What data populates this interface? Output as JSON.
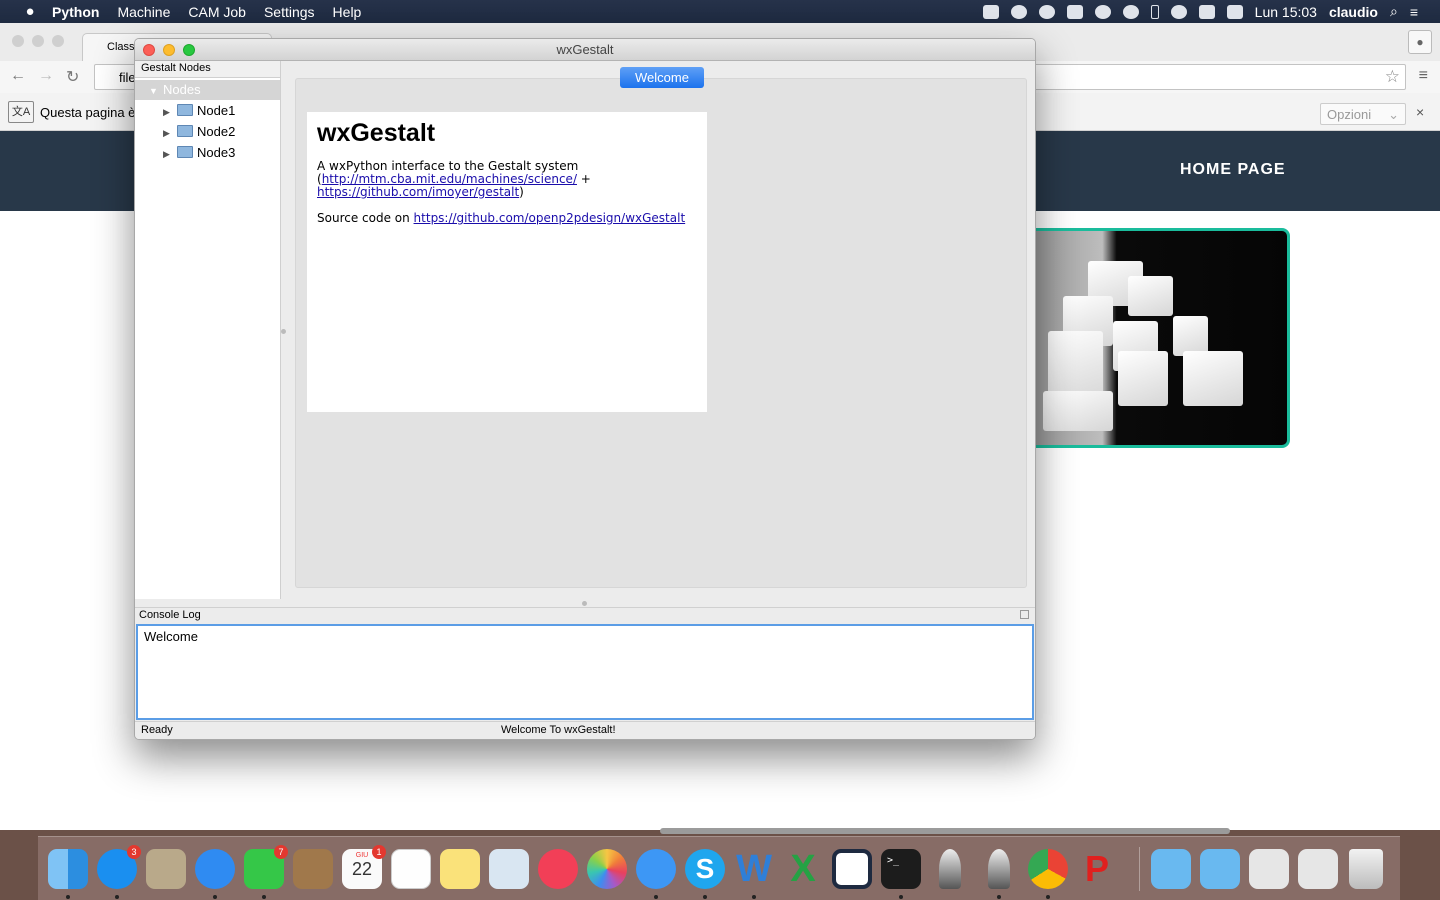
{
  "menubar": {
    "app_name": "Python",
    "menus": [
      "Machine",
      "CAM Job",
      "Settings",
      "Help"
    ],
    "clock": "Lun 15:03",
    "user": "claudio"
  },
  "browser": {
    "tab_title": "Class",
    "url_text": "file",
    "translate_bar_text": "Questa pagina è",
    "options_label": "Opzioni",
    "site_nav_label": "HOME PAGE"
  },
  "window": {
    "title": "wxGestalt",
    "tree": {
      "header": "Gestalt Nodes",
      "root": "Nodes",
      "nodes": [
        "Node1",
        "Node2",
        "Node3"
      ]
    },
    "notebook": {
      "active_tab": "Welcome"
    },
    "welcome_page": {
      "heading": "wxGestalt",
      "intro": "A wxPython interface to the Gestalt system",
      "link1": "http://mtm.cba.mit.edu/machines/science/",
      "link1_prefix": "(",
      "plus": " +",
      "link2": "https://github.com/imoyer/gestalt",
      "link2_suffix": ")",
      "source_prefix": "Source code on ",
      "source_link": "https://github.com/openp2pdesign/wxGestalt"
    },
    "console": {
      "header": "Console Log",
      "text": "Welcome"
    },
    "status": {
      "left": "Ready",
      "center": "Welcome To wxGestalt!"
    }
  },
  "dock": {
    "badges": {
      "app_store": "3",
      "facetime": "7",
      "calendar": "1"
    },
    "calendar_month": "GIU",
    "calendar_day": "22"
  },
  "colors": {
    "accent": "#1c72ed",
    "site_header": "#283849",
    "photo_border": "#1abc9c",
    "link": "#1a0dab"
  }
}
